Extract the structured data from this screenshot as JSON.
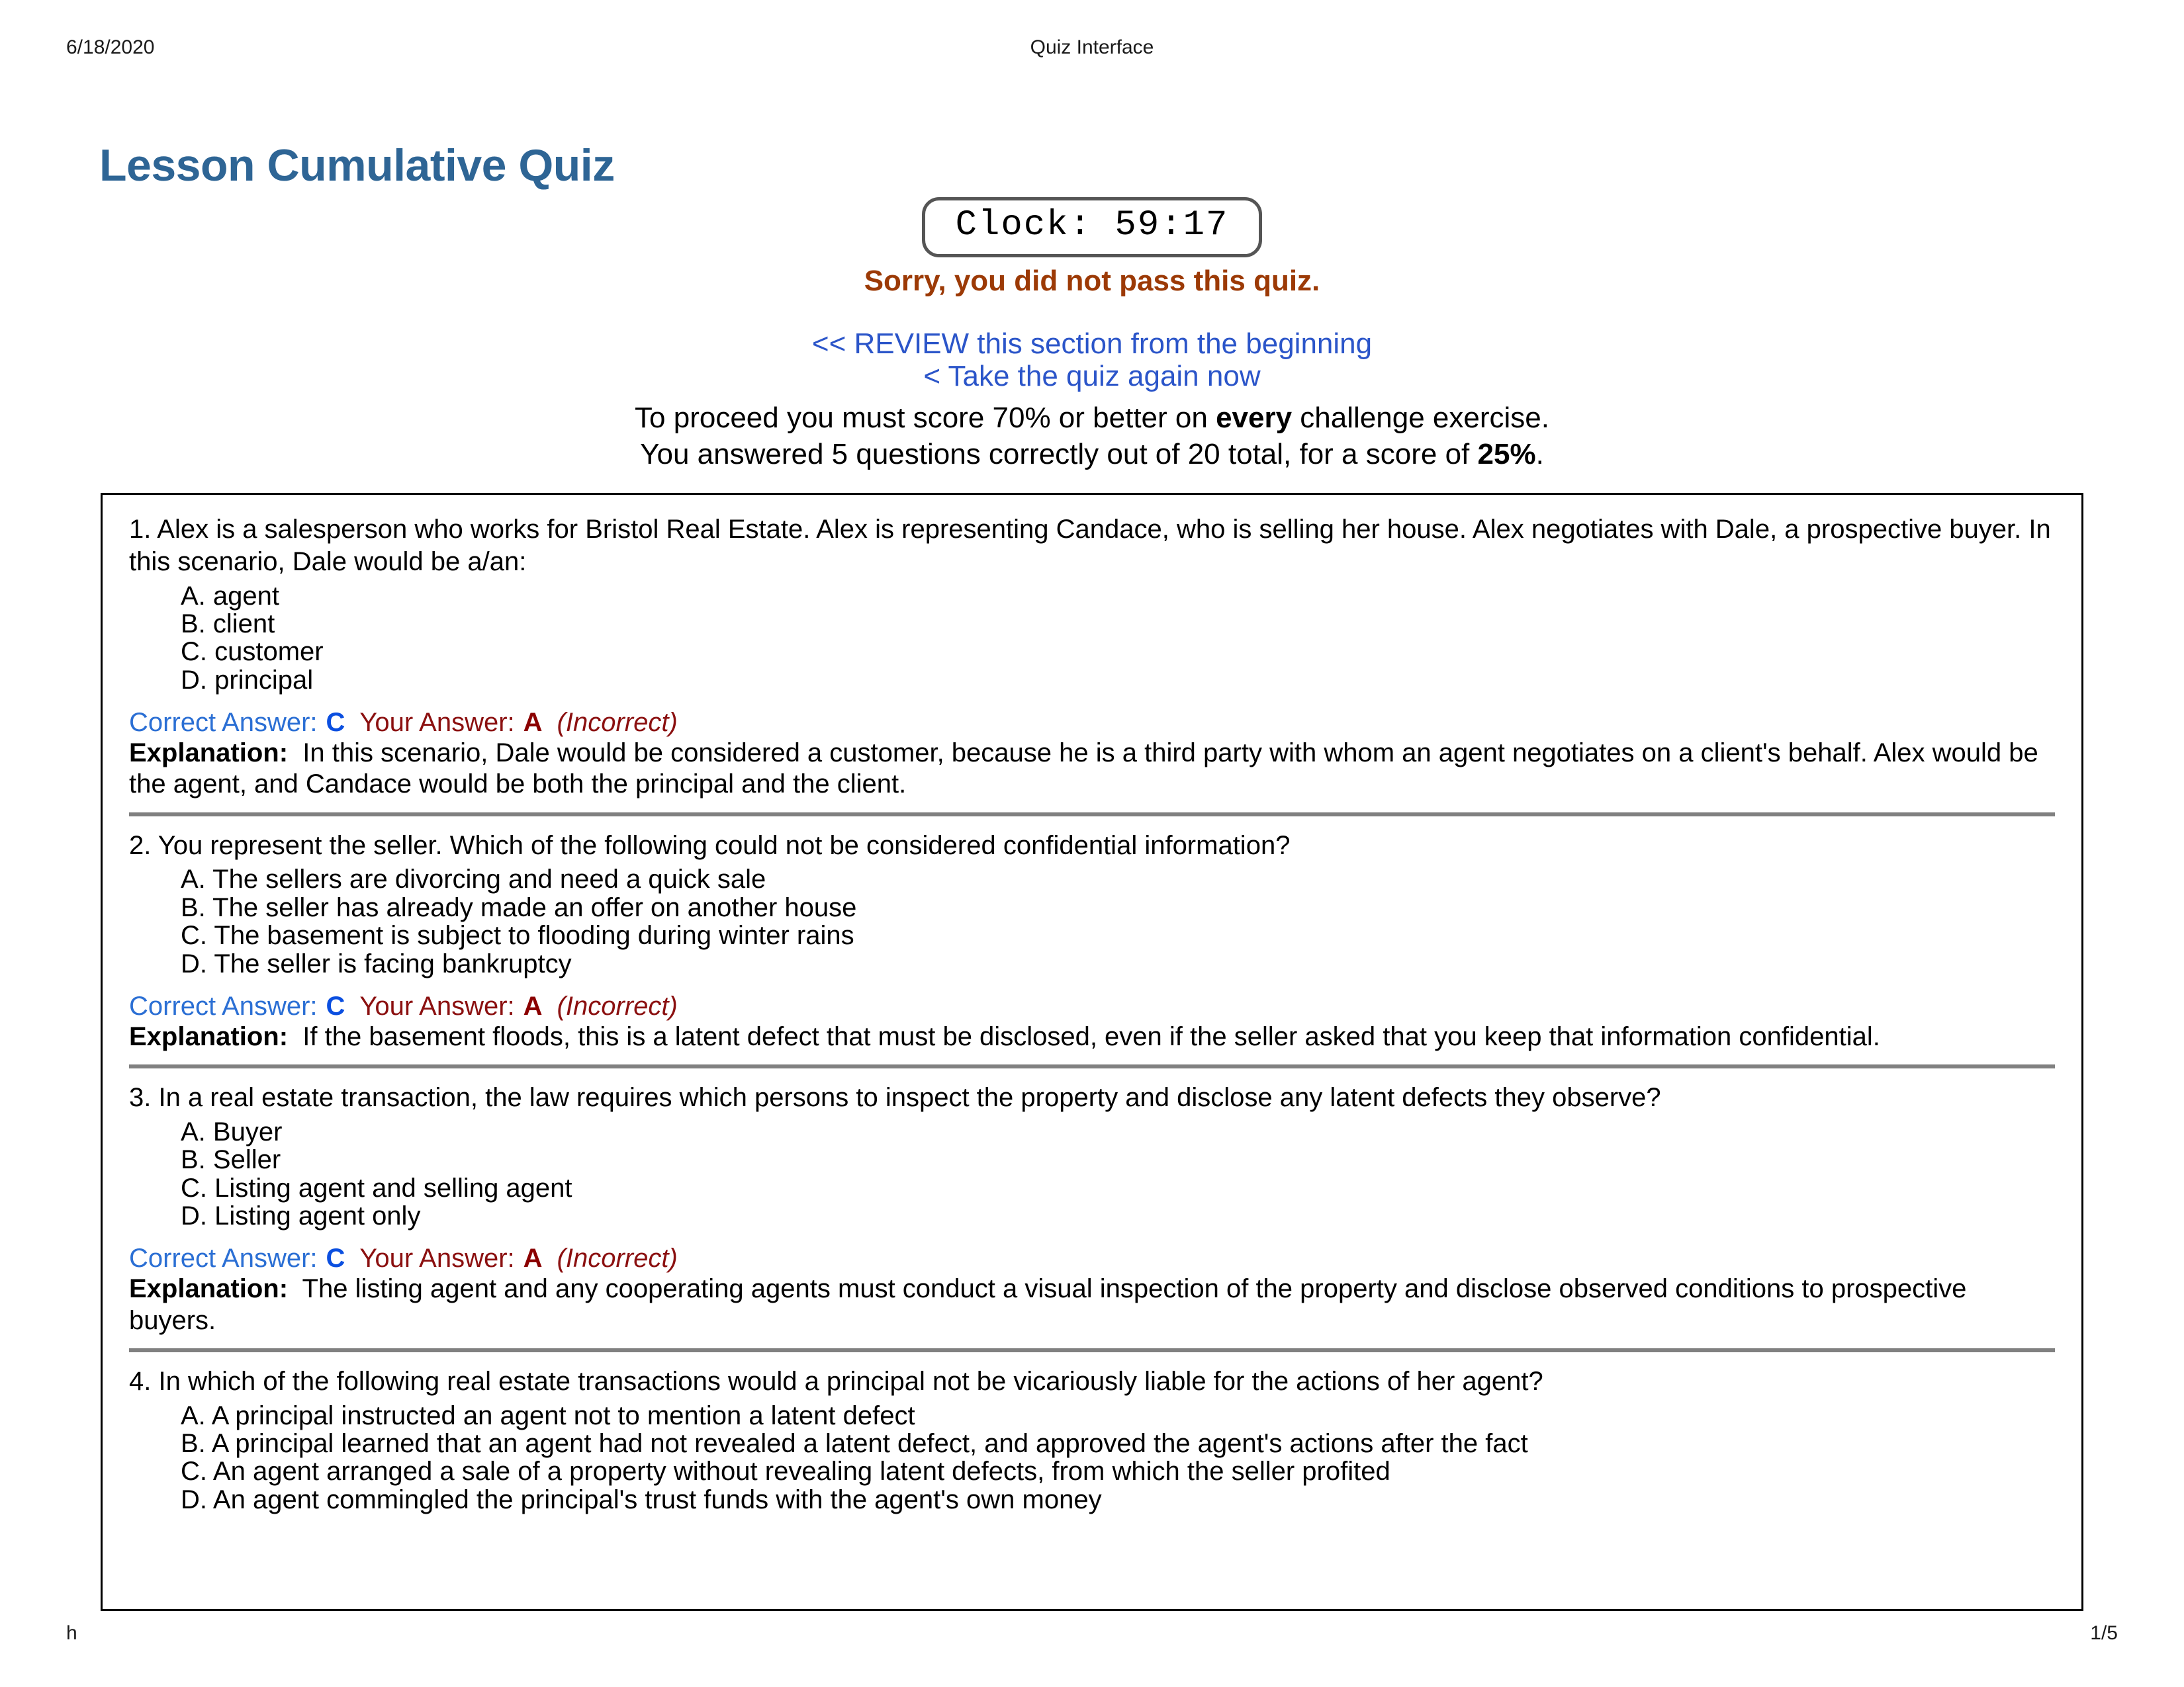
{
  "print_header": {
    "date": "6/18/2020",
    "document_title": "Quiz Interface"
  },
  "page_title": "Lesson Cumulative Quiz",
  "clock": {
    "label": "Clock: 59:17"
  },
  "status": {
    "fail_message": "Sorry, you did not pass this quiz.",
    "review_link": "<< REVIEW this section from the beginning",
    "retake_link": "< Take the quiz again now",
    "proceed_text_before": "To proceed you must score 70% or better on ",
    "proceed_emphasis": "every",
    "proceed_text_after": " challenge exercise.",
    "score_text_before": "You answered 5 questions correctly out of 20 total, for a score of ",
    "score_emphasis": "25%",
    "score_text_after": "."
  },
  "answer_labels": {
    "correct_label": "Correct Answer:",
    "your_label": "Your Answer:",
    "explanation_label": "Explanation:"
  },
  "colors": {
    "title_blue": "#2e6595",
    "fail_red": "#9c3a06",
    "link_blue": "#2b55c9",
    "correct_blue": "#0b4fe0",
    "your_answer_red": "#8b0000",
    "separator_gray": "#808080"
  },
  "questions": [
    {
      "stem": "1. Alex is a salesperson who works for Bristol Real Estate. Alex is representing Candace, who is selling her house. Alex negotiates with Dale, a prospective buyer. In this scenario, Dale would be a/an:",
      "choices": [
        "A. agent",
        "B. client",
        "C. customer",
        "D. principal"
      ],
      "correct_answer": "C",
      "your_answer": "A",
      "verdict": "(Incorrect)",
      "explanation": "In this scenario, Dale would be considered a customer, because he is a third party with whom an agent negotiates on a client's behalf. Alex would be the agent, and Candace would be both the principal and the client."
    },
    {
      "stem": "2. You represent the seller. Which of the following could not be considered confidential information?",
      "choices": [
        "A. The sellers are divorcing and need a quick sale",
        "B. The seller has already made an offer on another house",
        "C. The basement is subject to flooding during winter rains",
        "D. The seller is facing bankruptcy"
      ],
      "correct_answer": "C",
      "your_answer": "A",
      "verdict": "(Incorrect)",
      "explanation": "If the basement floods, this is a latent defect that must be disclosed, even if the seller asked that you keep that information confidential."
    },
    {
      "stem": "3. In a real estate transaction, the law requires which persons to inspect the property and disclose any latent defects they observe?",
      "choices": [
        "A. Buyer",
        "B. Seller",
        "C. Listing agent and selling agent",
        "D. Listing agent only"
      ],
      "correct_answer": "C",
      "your_answer": "A",
      "verdict": "(Incorrect)",
      "explanation": "The listing agent and any cooperating agents must conduct a visual inspection of the property and disclose observed conditions to prospective buyers."
    },
    {
      "stem": "4. In which of the following real estate transactions would a principal not be vicariously liable for the actions of her agent?",
      "choices": [
        "A. A principal instructed an agent not to mention a latent defect",
        "B. A principal learned that an agent had not revealed a latent defect, and approved the agent's actions after the fact",
        "C. An agent arranged a sale of a property without revealing latent defects, from which the seller profited",
        "D. An agent commingled the principal's trust funds with the agent's own money"
      ],
      "correct_answer": "",
      "your_answer": "",
      "verdict": "",
      "explanation": ""
    }
  ],
  "print_footer": {
    "left": "h",
    "page_number": "1/5"
  }
}
